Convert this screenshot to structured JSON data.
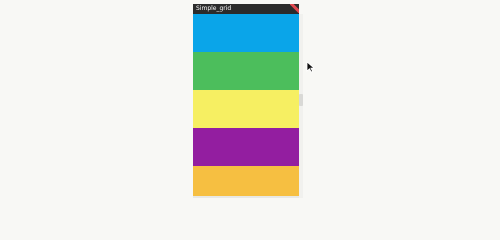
{
  "window": {
    "title": "Simple_grid",
    "debug_banner_icon": "debug-ribbon-icon",
    "accent": "#2b2b2b"
  },
  "grid": {
    "tiles": [
      {
        "name": "tile-blue",
        "color": "#0aa5e9"
      },
      {
        "name": "tile-green",
        "color": "#4cbe5c"
      },
      {
        "name": "tile-yellow",
        "color": "#f6ef62"
      },
      {
        "name": "tile-purple",
        "color": "#931ea0"
      },
      {
        "name": "tile-orange",
        "color": "#f6bf41"
      }
    ]
  },
  "cursor": {
    "icon": "mouse-pointer-icon"
  }
}
